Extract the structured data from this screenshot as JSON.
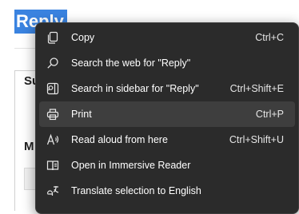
{
  "page": {
    "selected_title": "Reply",
    "label_top": "Su",
    "label_bottom": "M"
  },
  "menu": {
    "items": [
      {
        "label": "Copy",
        "shortcut": "Ctrl+C",
        "icon": "copy-icon"
      },
      {
        "label": "Search the web for \"Reply\"",
        "shortcut": "",
        "icon": "search-icon"
      },
      {
        "label": "Search in sidebar for \"Reply\"",
        "shortcut": "Ctrl+Shift+E",
        "icon": "sidebar-search-icon"
      },
      {
        "label": "Print",
        "shortcut": "Ctrl+P",
        "icon": "print-icon"
      },
      {
        "label": "Read aloud from here",
        "shortcut": "Ctrl+Shift+U",
        "icon": "read-aloud-icon"
      },
      {
        "label": "Open in Immersive Reader",
        "shortcut": "",
        "icon": "immersive-reader-icon"
      },
      {
        "label": "Translate selection to English",
        "shortcut": "",
        "icon": "translate-icon"
      }
    ]
  },
  "colors": {
    "menu_bg": "#2b2b2b",
    "hover_bg": "#3e3e3e",
    "selection_bg": "#3a83e0"
  }
}
